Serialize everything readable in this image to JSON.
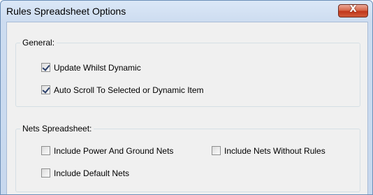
{
  "window": {
    "title": "Rules Spreadsheet Options",
    "close_glyph": "X"
  },
  "general": {
    "legend": "General:",
    "options": [
      {
        "label": "Update Whilst Dynamic",
        "checked": true
      },
      {
        "label": "Auto Scroll To Selected or Dynamic Item",
        "checked": true
      }
    ]
  },
  "nets": {
    "legend": "Nets Spreadsheet:",
    "options": [
      {
        "label": "Include Power And Ground Nets",
        "checked": false
      },
      {
        "label": "Include Nets Without Rules",
        "checked": false
      },
      {
        "label": "Include Default Nets",
        "checked": false
      }
    ]
  },
  "colors": {
    "title_bar": "#cddcf0",
    "close_button": "#c1371c",
    "client_bg": "#f0f0f0"
  }
}
